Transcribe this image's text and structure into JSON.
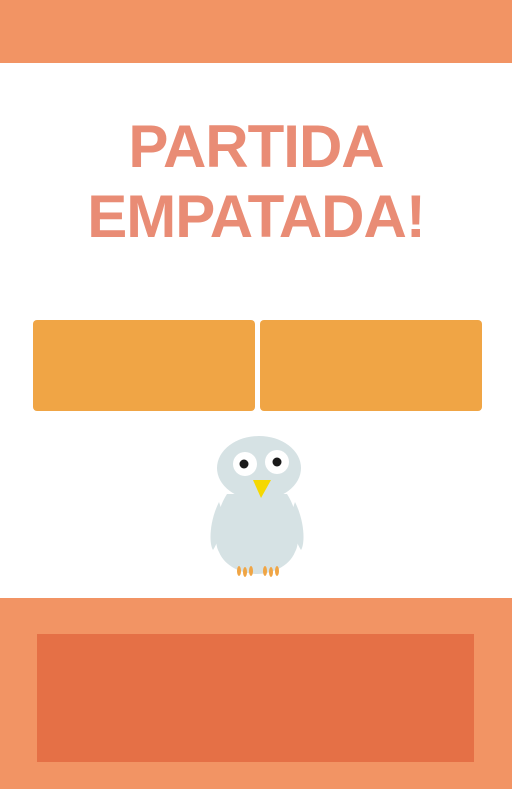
{
  "header": {
    "bar_color": "#F29464"
  },
  "result": {
    "line1": "PARTIDA",
    "line2": "EMPATADA!",
    "color": "#E98C75"
  },
  "choices": {
    "color": "#F0A545",
    "left_label": "",
    "right_label": ""
  },
  "mascot": {
    "icon": "owl-icon"
  },
  "footer": {
    "panel_color": "#F29464",
    "button_color": "#E57046",
    "button_label": ""
  }
}
